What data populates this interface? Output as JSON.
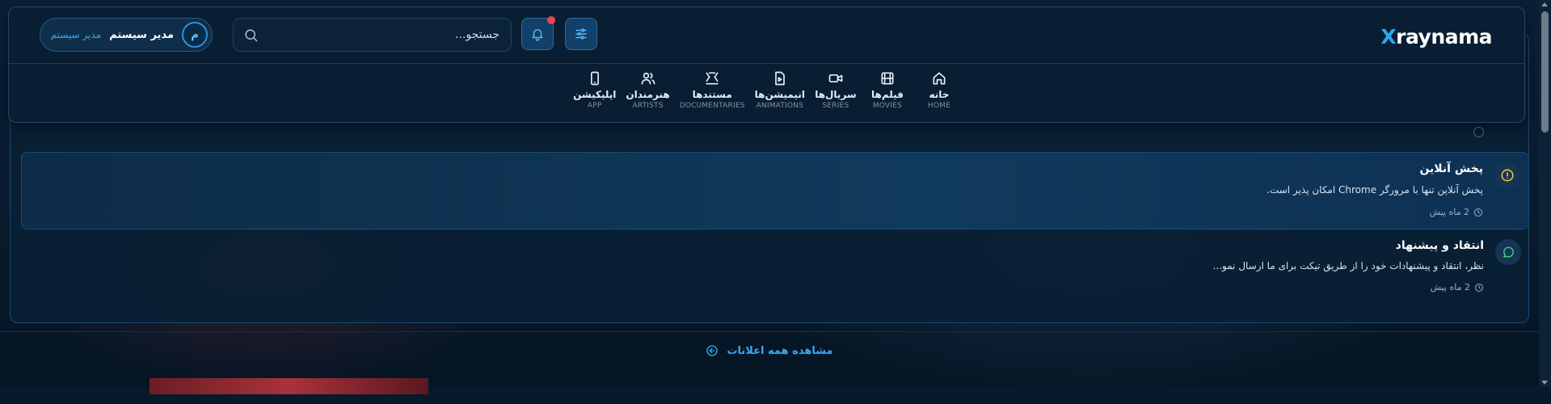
{
  "brand": {
    "logo_x": "X",
    "logo_rest": "raynama"
  },
  "header": {
    "search_placeholder": "جستجو...",
    "user": {
      "avatar_letter": "م",
      "name": "مدیر سیستم",
      "role": "مدیر سیستم"
    }
  },
  "nav": {
    "items": [
      {
        "label": "خانه",
        "sub": "HOME",
        "icon": "home-icon"
      },
      {
        "label": "فیلم‌ها",
        "sub": "MOVIES",
        "icon": "film-icon"
      },
      {
        "label": "سریال‌ها",
        "sub": "SERIES",
        "icon": "video-camera-icon"
      },
      {
        "label": "انیمیشن‌ها",
        "sub": "ANIMATIONS",
        "icon": "file-play-icon"
      },
      {
        "label": "مستندها",
        "sub": "DOCUMENTARIES",
        "icon": "theater-icon"
      },
      {
        "label": "هنرمندان",
        "sub": "ARTISTS",
        "icon": "users-icon"
      },
      {
        "label": "اپلیکیشن",
        "sub": "APP",
        "icon": "smartphone-icon"
      }
    ]
  },
  "notifications": {
    "items": [
      {
        "title": "پخش آنلاین",
        "message": "پخش آنلاین تنها با مرورگر Chrome امکان پذیر است.",
        "time": "2 ماه پیش",
        "icon": "alert-circle-icon",
        "icon_color": "#f2c94c"
      },
      {
        "title": "انتقاد و پیشنهاد",
        "message": "نظر، انتقاد و پیشنهادات خود را از طریق تیکت برای ما ارسال نمو...",
        "time": "2 ماه پیش",
        "icon": "message-circle-icon",
        "icon_color": "#3ecf8e"
      }
    ],
    "view_all_label": "مشاهده همه اعلانات"
  },
  "colors": {
    "accent": "#2fa4f2",
    "badge": "#e5484d",
    "panel": "#0a1f34"
  }
}
